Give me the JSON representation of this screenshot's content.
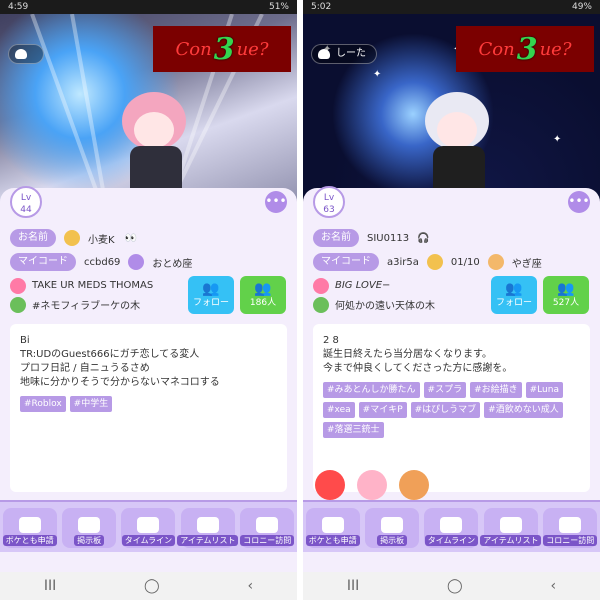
{
  "left": {
    "status": {
      "time": "4:59",
      "battery": "51%"
    },
    "bubble": {
      "text": ""
    },
    "banner": {
      "left": "Con",
      "num": "3",
      "right": "ue?"
    },
    "level": {
      "lv": "Lv",
      "value": "44"
    },
    "name": {
      "label": "お名前",
      "value": "小麦K"
    },
    "mycode": {
      "label": "マイコード",
      "value": "ccbd69",
      "zodiac": "おとめ座"
    },
    "lines": [
      "TAKE UR MEDS THOMAS",
      "#ネモフィラブーケの木"
    ],
    "follow": {
      "label": "フォロー"
    },
    "followers": {
      "count": "186人"
    },
    "bio": {
      "lines": [
        "Bi",
        "",
        "TR:UDのGuest666にガチ恋してる変人",
        "",
        "",
        "プロフ日記 / 自ニュうるさめ",
        "地味に分かりそうで分からないマネコロする"
      ],
      "tags": [
        "#Roblox",
        "#中学生"
      ]
    }
  },
  "right": {
    "status": {
      "time": "5:02",
      "battery": "49%"
    },
    "bubble": {
      "text": "しーた"
    },
    "banner": {
      "left": "Con",
      "num": "3",
      "right": "ue?"
    },
    "level": {
      "lv": "Lv",
      "value": "63"
    },
    "name": {
      "label": "お名前",
      "value": "SIU0113"
    },
    "mycode": {
      "label": "マイコード",
      "value": "a3ir5a",
      "birthday": "01/10",
      "zodiac": "やぎ座"
    },
    "lines": [
      "BIG LOVE−",
      "何処かの遠い天体の木"
    ],
    "follow": {
      "label": "フォロー"
    },
    "followers": {
      "count": "527人"
    },
    "bio": {
      "lines": [
        "2 8",
        "",
        "誕生日終えたら当分居なくなります。",
        "今まで仲良くしてくださった方に感謝を。"
      ],
      "tags": [
        "#みあとんしか勝たん",
        "#スプラ",
        "#お絵描き",
        "#Luna",
        "#xea",
        "#マイキP",
        "#はぴしうマブ",
        "#酒飲めない成人",
        "#落選三銃士"
      ]
    }
  },
  "nav": {
    "items": [
      "ボケとも申請",
      "掲示板",
      "タイムライン",
      "アイテムリスト",
      "コロニー訪問"
    ]
  },
  "system": {
    "nav": [
      "III",
      "◯",
      "‹"
    ]
  }
}
